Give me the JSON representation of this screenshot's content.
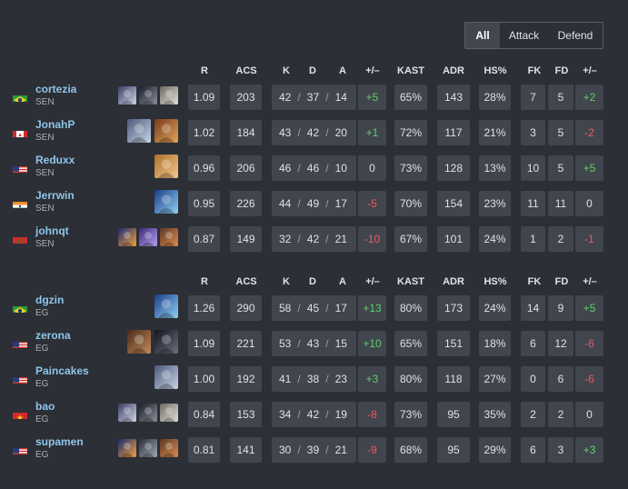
{
  "filter": {
    "options": [
      "All",
      "Attack",
      "Defend"
    ],
    "selected": "All"
  },
  "headers": [
    "R",
    "ACS",
    "K",
    "D",
    "A",
    "+/–",
    "KAST",
    "ADR",
    "HS%",
    "FK",
    "FD",
    "+/–"
  ],
  "teams": [
    {
      "code": "SEN",
      "players": [
        {
          "name": "cortezia",
          "team": "SEN",
          "flag": "brazil-flag",
          "agents": [
            "agent-icon-1",
            "agent-icon-2",
            "agent-icon-3"
          ],
          "r": "1.09",
          "acs": "203",
          "k": "42",
          "d": "37",
          "a": "14",
          "kd_diff": "+5",
          "kast": "65%",
          "adr": "143",
          "hs": "28%",
          "fk": "7",
          "fd": "5",
          "fk_diff": "+2"
        },
        {
          "name": "JonahP",
          "team": "SEN",
          "flag": "canada-flag",
          "agents": [
            "agent-icon-4",
            "agent-icon-5"
          ],
          "r": "1.02",
          "acs": "184",
          "k": "43",
          "d": "42",
          "a": "20",
          "kd_diff": "+1",
          "kast": "72%",
          "adr": "117",
          "hs": "21%",
          "fk": "3",
          "fd": "5",
          "fk_diff": "-2"
        },
        {
          "name": "Reduxx",
          "team": "SEN",
          "flag": "usa-flag",
          "agents": [
            "agent-icon-6"
          ],
          "r": "0.96",
          "acs": "206",
          "k": "46",
          "d": "46",
          "a": "10",
          "kd_diff": "0",
          "kast": "73%",
          "adr": "128",
          "hs": "13%",
          "fk": "10",
          "fd": "5",
          "fk_diff": "+5"
        },
        {
          "name": "Jerrwin",
          "team": "SEN",
          "flag": "india-flag",
          "agents": [
            "agent-icon-7"
          ],
          "r": "0.95",
          "acs": "226",
          "k": "44",
          "d": "49",
          "a": "17",
          "kd_diff": "-5",
          "kast": "70%",
          "adr": "154",
          "hs": "23%",
          "fk": "11",
          "fd": "11",
          "fk_diff": "0"
        },
        {
          "name": "johnqt",
          "team": "SEN",
          "flag": "morocco-flag",
          "agents": [
            "agent-icon-8",
            "agent-icon-9",
            "agent-icon-10"
          ],
          "r": "0.87",
          "acs": "149",
          "k": "32",
          "d": "42",
          "a": "21",
          "kd_diff": "-10",
          "kast": "67%",
          "adr": "101",
          "hs": "24%",
          "fk": "1",
          "fd": "2",
          "fk_diff": "-1"
        }
      ]
    },
    {
      "code": "EG",
      "players": [
        {
          "name": "dgzin",
          "team": "EG",
          "flag": "brazil-flag",
          "agents": [
            "agent-icon-7"
          ],
          "r": "1.26",
          "acs": "290",
          "k": "58",
          "d": "45",
          "a": "17",
          "kd_diff": "+13",
          "kast": "80%",
          "adr": "173",
          "hs": "24%",
          "fk": "14",
          "fd": "9",
          "fk_diff": "+5"
        },
        {
          "name": "zerona",
          "team": "EG",
          "flag": "usa-flag",
          "agents": [
            "agent-icon-11",
            "agent-icon-12"
          ],
          "r": "1.09",
          "acs": "221",
          "k": "53",
          "d": "43",
          "a": "15",
          "kd_diff": "+10",
          "kast": "65%",
          "adr": "151",
          "hs": "18%",
          "fk": "6",
          "fd": "12",
          "fk_diff": "-6"
        },
        {
          "name": "Paincakes",
          "team": "EG",
          "flag": "usa-flag",
          "agents": [
            "agent-icon-4"
          ],
          "r": "1.00",
          "acs": "192",
          "k": "41",
          "d": "38",
          "a": "23",
          "kd_diff": "+3",
          "kast": "80%",
          "adr": "118",
          "hs": "27%",
          "fk": "0",
          "fd": "6",
          "fk_diff": "-6"
        },
        {
          "name": "bao",
          "team": "EG",
          "flag": "vietnam-flag",
          "agents": [
            "agent-icon-1",
            "agent-icon-2",
            "agent-icon-3"
          ],
          "r": "0.84",
          "acs": "153",
          "k": "34",
          "d": "42",
          "a": "19",
          "kd_diff": "-8",
          "kast": "73%",
          "adr": "95",
          "hs": "35%",
          "fk": "2",
          "fd": "2",
          "fk_diff": "0"
        },
        {
          "name": "supamen",
          "team": "EG",
          "flag": "usa-flag",
          "agents": [
            "agent-icon-8",
            "agent-icon-13",
            "agent-icon-10"
          ],
          "r": "0.81",
          "acs": "141",
          "k": "30",
          "d": "39",
          "a": "21",
          "kd_diff": "-9",
          "kast": "68%",
          "adr": "95",
          "hs": "29%",
          "fk": "6",
          "fd": "3",
          "fk_diff": "+3"
        }
      ]
    }
  ],
  "colors": {
    "background": "#2c2f35",
    "cell": "#41454d",
    "player_name": "#8fc5ea",
    "positive": "#5fd06a",
    "negative": "#f05a5a"
  }
}
